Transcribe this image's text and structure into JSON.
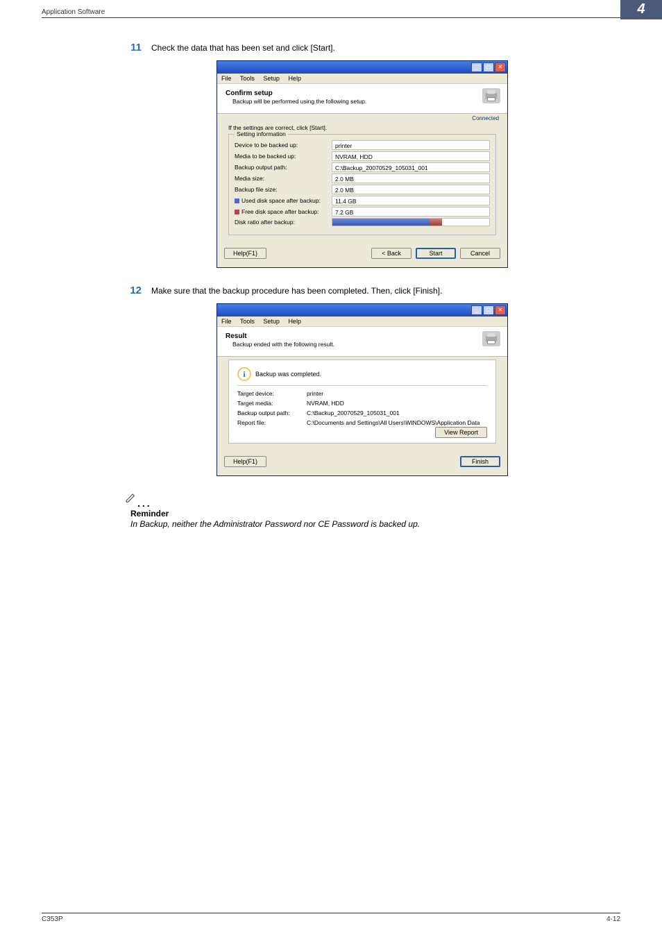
{
  "header": {
    "section": "Application Software",
    "chapter": "4"
  },
  "step11": {
    "num": "11",
    "text": "Check the data that has been set and click [Start].",
    "menus": {
      "file": "File",
      "tools": "Tools",
      "setup": "Setup",
      "help": "Help"
    },
    "banner_title": "Confirm setup",
    "banner_sub": "Backup will be performed using the following setup.",
    "connected": "Connected",
    "instruction": "If the settings are correct, click [Start].",
    "group_label": "Setting information",
    "labels": {
      "device": "Device to be backed up:",
      "media": "Media to be backed up:",
      "path": "Backup output path:",
      "msize": "Media size:",
      "bsize": "Backup file size:",
      "used": "Used disk space after backup:",
      "free": "Free disk space after backup:",
      "ratio": "Disk ratio after backup:"
    },
    "values": {
      "device": "printer",
      "media": "NVRAM, HDD",
      "path": "C:\\Backup_20070529_105031_001",
      "msize": "2.0 MB",
      "bsize": "2.0 MB",
      "used": "11.4 GB",
      "free": "7.2 GB"
    },
    "buttons": {
      "help": "Help(F1)",
      "back": "< Back",
      "start": "Start",
      "cancel": "Cancel"
    }
  },
  "step12": {
    "num": "12",
    "text": "Make sure that the backup procedure has been completed. Then, click [Finish].",
    "menus": {
      "file": "File",
      "tools": "Tools",
      "setup": "Setup",
      "help": "Help"
    },
    "banner_title": "Result",
    "banner_sub": "Backup ended with the following result.",
    "completed": "Backup was completed.",
    "labels": {
      "tdevice": "Target device:",
      "tmedia": "Target media:",
      "path": "Backup output path:",
      "report": "Report file:"
    },
    "values": {
      "tdevice": "printer",
      "tmedia": "NVRAM, HDD",
      "path": "C:\\Backup_20070529_105031_001",
      "report": "C:\\Documents and Settings\\All Users\\WINDOWS\\Application Data"
    },
    "view_report": "View Report",
    "buttons": {
      "help": "Help(F1)",
      "finish": "Finish"
    }
  },
  "reminder": {
    "title": "Reminder",
    "body": "In Backup, neither the Administrator Password nor CE Password is backed up."
  },
  "footer": {
    "left": "C353P",
    "right": "4-12"
  }
}
